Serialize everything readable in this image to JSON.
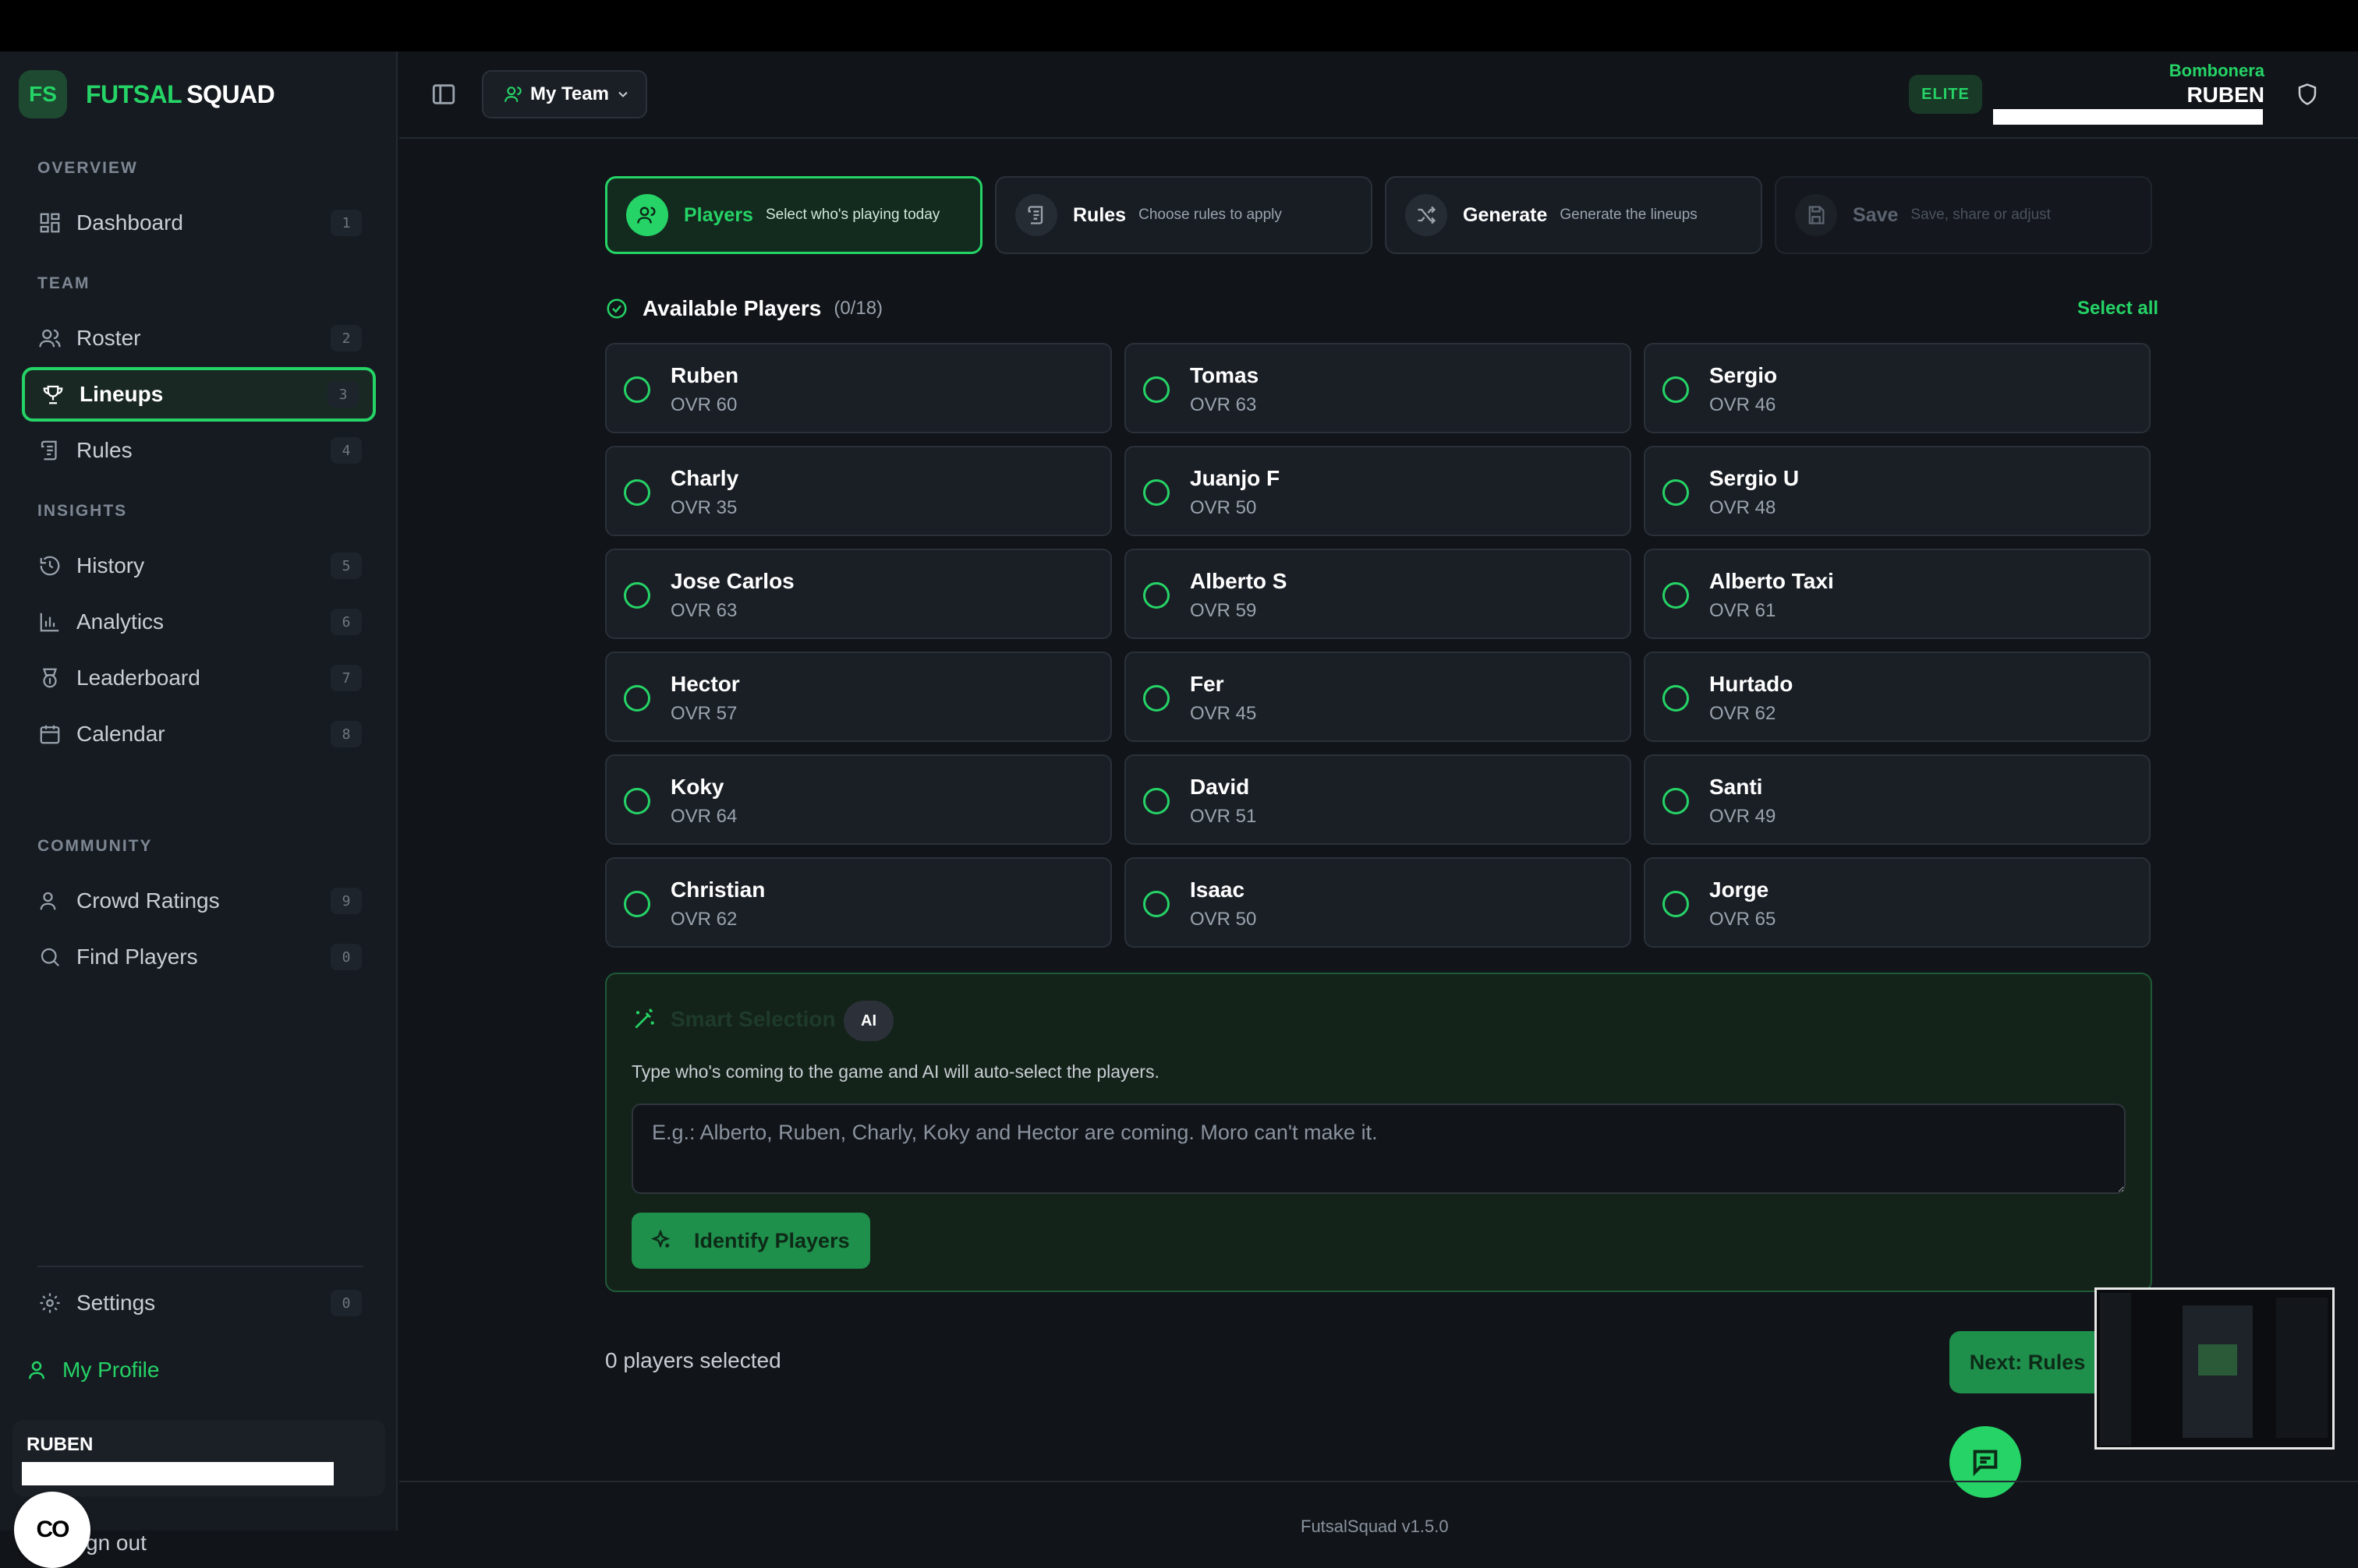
{
  "app": {
    "brand_logo": "FS",
    "brand_name_a": "FUTSAL",
    "brand_name_b": "SQUAD"
  },
  "sidebar": {
    "sections": {
      "overview": "OVERVIEW",
      "team": "TEAM",
      "insights": "INSIGHTS",
      "community": "COMMUNITY"
    },
    "items": [
      {
        "label": "Dashboard",
        "key": "1",
        "icon": "dashboard-icon"
      },
      {
        "label": "Roster",
        "key": "2",
        "icon": "users-icon"
      },
      {
        "label": "Lineups",
        "key": "3",
        "icon": "trophy-icon",
        "active": true
      },
      {
        "label": "Rules",
        "key": "4",
        "icon": "scroll-icon"
      },
      {
        "label": "History",
        "key": "5",
        "icon": "history-icon"
      },
      {
        "label": "Analytics",
        "key": "6",
        "icon": "bar-chart-icon"
      },
      {
        "label": "Leaderboard",
        "key": "7",
        "icon": "award-icon"
      },
      {
        "label": "Calendar",
        "key": "8",
        "icon": "calendar-icon"
      },
      {
        "label": "Crowd Ratings",
        "key": "9",
        "icon": "user-icon"
      },
      {
        "label": "Find Players",
        "key": "0",
        "icon": "search-icon"
      }
    ],
    "settings": {
      "label": "Settings",
      "key": "0"
    },
    "profile_label": "My Profile",
    "user_name": "RUBEN",
    "signout": "gn out",
    "cc_label": "CO"
  },
  "header": {
    "team_button": "My Team",
    "badge": "ELITE",
    "team_name": "Bombonera",
    "user_name": "RUBEN"
  },
  "steps": [
    {
      "title": "Players",
      "subtitle": "Select who's playing today",
      "state": "active"
    },
    {
      "title": "Rules",
      "subtitle": "Choose rules to apply",
      "state": "normal"
    },
    {
      "title": "Generate",
      "subtitle": "Generate the lineups",
      "state": "normal"
    },
    {
      "title": "Save",
      "subtitle": "Save, share or adjust",
      "state": "disabled"
    }
  ],
  "available": {
    "title": "Available Players",
    "count": "(0/18)",
    "select_all": "Select all"
  },
  "players": [
    {
      "name": "Ruben",
      "ovr": "OVR 60"
    },
    {
      "name": "Tomas",
      "ovr": "OVR 63"
    },
    {
      "name": "Sergio",
      "ovr": "OVR 46"
    },
    {
      "name": "Charly",
      "ovr": "OVR 35"
    },
    {
      "name": "Juanjo F",
      "ovr": "OVR 50"
    },
    {
      "name": "Sergio U",
      "ovr": "OVR 48"
    },
    {
      "name": "Jose Carlos",
      "ovr": "OVR 63"
    },
    {
      "name": "Alberto S",
      "ovr": "OVR 59"
    },
    {
      "name": "Alberto Taxi",
      "ovr": "OVR 61"
    },
    {
      "name": "Hector",
      "ovr": "OVR 57"
    },
    {
      "name": "Fer",
      "ovr": "OVR 45"
    },
    {
      "name": "Hurtado",
      "ovr": "OVR 62"
    },
    {
      "name": "Koky",
      "ovr": "OVR 64"
    },
    {
      "name": "David",
      "ovr": "OVR 51"
    },
    {
      "name": "Santi",
      "ovr": "OVR 49"
    },
    {
      "name": "Christian",
      "ovr": "OVR 62"
    },
    {
      "name": "Isaac",
      "ovr": "OVR 50"
    },
    {
      "name": "Jorge",
      "ovr": "OVR 65"
    }
  ],
  "smart": {
    "title": "Smart Selection",
    "badge": "AI",
    "description": "Type who's coming to the game and AI will auto-select the players.",
    "placeholder": "E.g.: Alberto, Ruben, Charly, Koky and Hector are coming. Moro can't make it.",
    "button": "Identify Players"
  },
  "footer": {
    "selected": "0 players selected",
    "next": "Next: Rules",
    "version": "FutsalSquad v1.5.0"
  },
  "colors": {
    "accent": "#25d366",
    "bg": "#111419",
    "sidebar": "#161b21"
  }
}
